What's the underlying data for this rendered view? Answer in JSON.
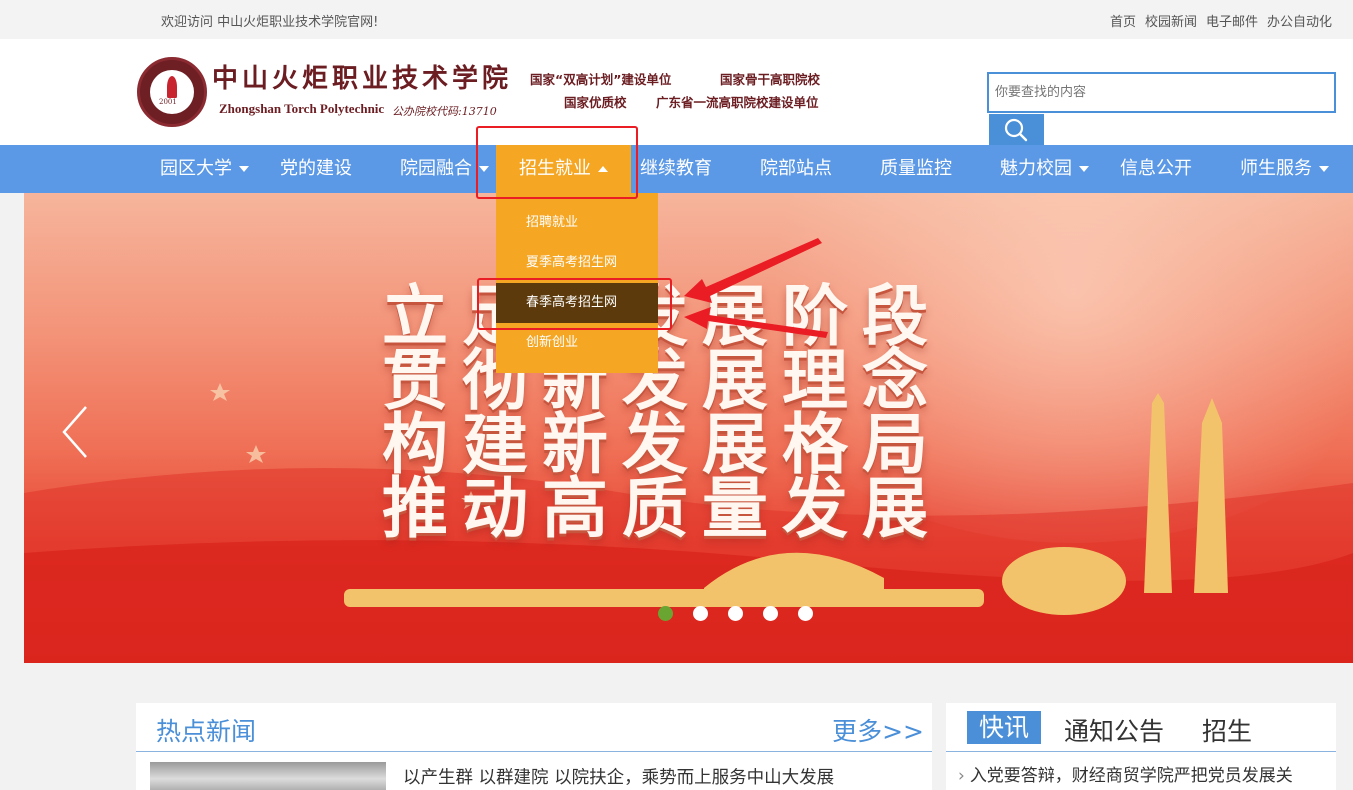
{
  "topbar": {
    "welcome": "欢迎访问 中山火炬职业技术学院官网!",
    "links": [
      "首页",
      "校园新闻",
      "电子邮件",
      "办公自动化"
    ]
  },
  "header": {
    "school_name_cn": "中山火炬职业技术学院",
    "school_name_en": "Zhongshan Torch Polytechnic",
    "school_code": "公办院校代码:13710",
    "seal_year": "2001",
    "tags": [
      "国家“双高计划”建设单位",
      "国家骨干高职院校",
      "国家优质校",
      "广东省一流高职院校建设单位"
    ],
    "search_placeholder": "你要查找的内容",
    "search_icon": "search-icon"
  },
  "nav": {
    "items": [
      {
        "label": "园区大学",
        "has_dropdown": true
      },
      {
        "label": "党的建设",
        "has_dropdown": false
      },
      {
        "label": "院园融合",
        "has_dropdown": true
      },
      {
        "label": "招生就业",
        "has_dropdown": true,
        "active": true
      },
      {
        "label": "继续教育",
        "has_dropdown": false
      },
      {
        "label": "院部站点",
        "has_dropdown": false
      },
      {
        "label": "质量监控",
        "has_dropdown": false
      },
      {
        "label": "魅力校园",
        "has_dropdown": true
      },
      {
        "label": "信息公开",
        "has_dropdown": false
      },
      {
        "label": "师生服务",
        "has_dropdown": true
      }
    ],
    "dropdown": [
      "招聘就业",
      "夏季高考招生网",
      "春季高考招生网",
      "创新创业"
    ],
    "dropdown_selected": "春季高考招生网"
  },
  "banner": {
    "lines": [
      "立足新发展阶段",
      "贯彻新发展理念",
      "构建新发展格局",
      "推动高质量发展"
    ],
    "slide_count": 5,
    "active_slide": 1,
    "prev_icon": "chevron-left-icon"
  },
  "news": {
    "title": "热点新闻",
    "more": "更多>>",
    "headline": "以产生群 以群建院 以院扶企，乘势而上服务中山大发展"
  },
  "side": {
    "tabs": [
      "快讯",
      "通知公告",
      "招生"
    ],
    "active_tab": "快讯",
    "item": "入党要答辩，财经商贸学院严把党员发展关"
  },
  "colors": {
    "nav_bg": "#5b98e6",
    "active_orange": "#f5a623",
    "dropdown_selected": "#5c3a0b",
    "annotation_red": "#ea1c24",
    "brand_maroon": "#6b1d22",
    "link_blue": "#4a8fd8"
  }
}
